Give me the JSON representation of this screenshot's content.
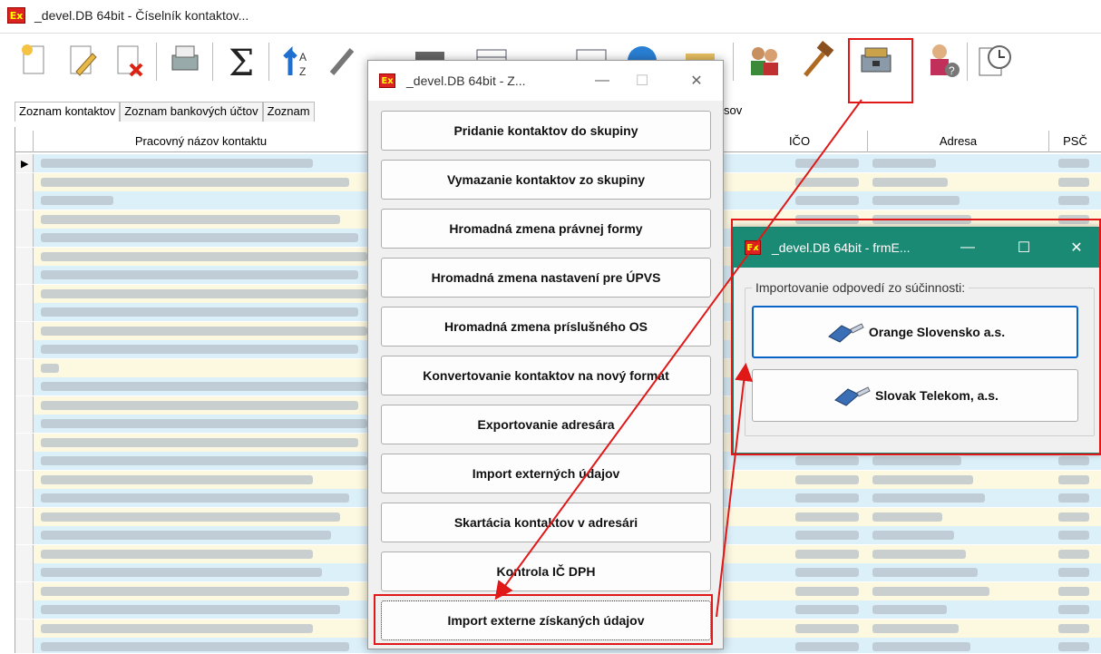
{
  "main_window": {
    "title": "_devel.DB 64bit - Číselník kontaktov...",
    "app_icon_label": "Ex"
  },
  "toolbar": {
    "icons": [
      "new-record-icon",
      "edit-record-icon",
      "delete-record-icon",
      "print-icon",
      "sum-icon",
      "sort-icon",
      "tools-icon",
      "camera-icon",
      "grid-icon",
      "grid2-icon",
      "globe-icon",
      "folder-icon",
      "users-icon",
      "hammer-icon",
      "toolbox-icon",
      "user-help-icon",
      "clock-icon"
    ]
  },
  "tabs": {
    "tab1": "Zoznam kontaktov",
    "tab2": "Zoznam bankových účtov",
    "tab3": "Zoznam",
    "tab_right": "sov"
  },
  "grid": {
    "columns": [
      "Pracovný názov kontaktu",
      "IČO",
      "Adresa",
      "PSČ"
    ],
    "row_indicator": "▶"
  },
  "dialog1": {
    "title": "_devel.DB 64bit - Z...",
    "app_icon_label": "Ex",
    "buttons": [
      "Pridanie kontaktov do skupiny",
      "Vymazanie kontaktov zo skupiny",
      "Hromadná zmena právnej formy",
      "Hromadná zmena nastavení pre ÚPVS",
      "Hromadná zmena príslušného OS",
      "Konvertovanie kontaktov na nový formát",
      "Exportovanie adresára",
      "Import externých údajov",
      "Skartácia kontaktov v adresári",
      "Kontrola IČ DPH",
      "Import externe získaných údajov"
    ],
    "minimize": "—",
    "maximize": "☐",
    "close": "✕"
  },
  "dialog2": {
    "title": "_devel.DB 64bit - frmE...",
    "app_icon_label": "Ex",
    "group_label": "Importovanie odpovedí zo súčinnosti:",
    "button1": "Orange Slovensko a.s.",
    "button2": "Slovak Telekom, a.s.",
    "minimize": "—",
    "maximize": "☐",
    "close": "✕"
  },
  "colors": {
    "annotation": "#e01818",
    "dialog2_titlebar": "#1b8a75",
    "row_alt_1": "#dcf0fa",
    "row_alt_2": "#fdf8e0"
  }
}
